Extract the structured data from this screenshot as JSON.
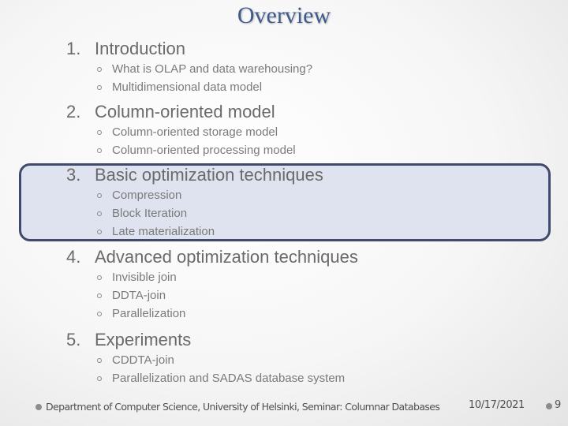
{
  "slide": {
    "title": "Overview",
    "sections": [
      {
        "number": "1.",
        "label": "Introduction",
        "items": [
          "What is OLAP and data warehousing?",
          "Multidimensional data model"
        ],
        "highlighted": false
      },
      {
        "number": "2.",
        "label": "Column-oriented model",
        "items": [
          "Column-oriented storage model",
          "Column-oriented processing model"
        ],
        "highlighted": false
      },
      {
        "number": "3.",
        "label": "Basic optimization techniques",
        "items": [
          "Compression",
          "Block Iteration",
          "Late materialization"
        ],
        "highlighted": true
      },
      {
        "number": "4.",
        "label": "Advanced optimization techniques",
        "items": [
          "Invisible join",
          "DDTA-join",
          "Parallelization"
        ],
        "highlighted": false
      },
      {
        "number": "5.",
        "label": "Experiments",
        "items": [
          "CDDTA-join",
          "Parallelization and SADAS database system"
        ],
        "highlighted": false
      }
    ],
    "footer": {
      "text": "Department of Computer Science, University of Helsinki, Seminar: Columnar Databases",
      "date": "10/17/2021",
      "page": "9"
    }
  },
  "colors": {
    "title": "#3f5b8c",
    "highlight_fill": "#dfe3ef",
    "highlight_border": "#414a6c",
    "text": "#6a6a6a"
  }
}
